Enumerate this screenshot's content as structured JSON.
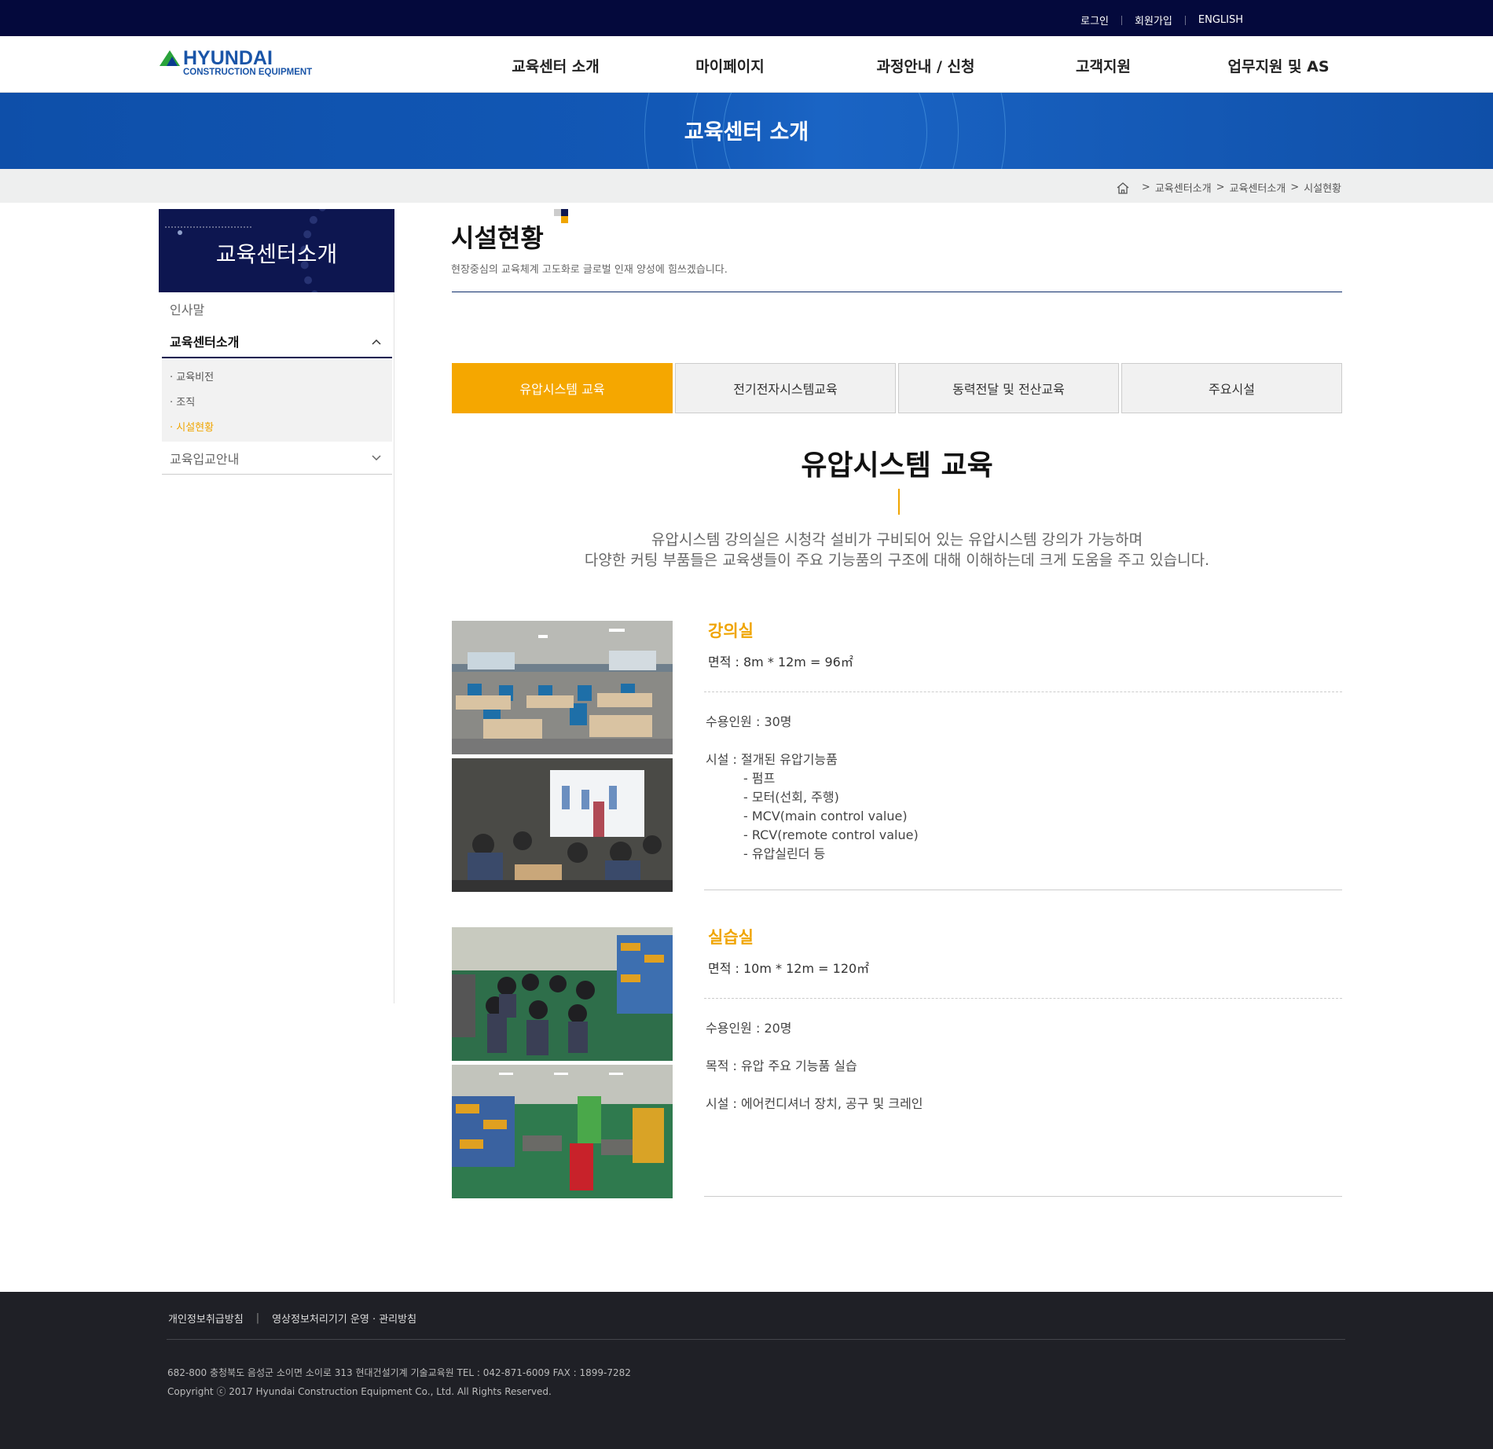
{
  "util": {
    "login": "로그인",
    "join": "회원가입",
    "english": "ENGLISH"
  },
  "logo": {
    "name": "HYUNDAI",
    "sub": "CONSTRUCTION EQUIPMENT"
  },
  "gnb": [
    "교육센터 소개",
    "마이페이지",
    "과정안내 / 신청",
    "고객지원",
    "업무지원 및 AS"
  ],
  "banner_title": "교육센터 소개",
  "breadcrumb": [
    "교육센터소개",
    "교육센터소개",
    "시설현황"
  ],
  "side": {
    "head": "교육센터소개",
    "items": [
      "인사말",
      "교육센터소개",
      "교육입교안내"
    ],
    "sub": [
      "· 교육비전",
      "· 조직",
      "· 시설현황"
    ]
  },
  "page": {
    "title": "시설현황",
    "subtitle": "현장중심의 교육체계 고도화로 글로벌 인재 양성에 힘쓰겠습니다."
  },
  "tabs": [
    "유압시스템 교육",
    "전기전자시스템교육",
    "동력전달 및 전산교육",
    "주요시설"
  ],
  "section": {
    "title": "유압시스템 교육",
    "desc1": "유압시스템 강의실은 시청각 설비가 구비되어 있는 유압시스템 강의가 가능하며",
    "desc2": "다양한 커팅 부품들은 교육생들이 주요 기능품의 구조에 대해 이해하는데 크게 도움을 주고 있습니다."
  },
  "rooms": [
    {
      "name": "강의실",
      "area": "면적 : 8m * 12m = 96㎡",
      "capacity": "수용인원 : 30명",
      "facility": "시설 : 절개된 유압기능품",
      "items": [
        "- 펌프",
        "- 모터(선회, 주행)",
        "- MCV(main control value)",
        "- RCV(remote control value)",
        "- 유압실린더 등"
      ]
    },
    {
      "name": "실습실",
      "area": "면적 : 10m * 12m = 120㎡",
      "capacity": "수용인원 : 20명",
      "purpose": "목적 : 유압 주요 기능품 실습",
      "facility": "시설 : 에어컨디셔너 장치, 공구 및 크레인"
    }
  ],
  "footer": {
    "link1": "개인정보취급방침",
    "link2": "영상정보처리기기 운영 · 관리방침",
    "address": "682-800  충청북도 음성군 소이면 소이로 313 현대건설기계 기술교육원 TEL : 042-871-6009 FAX : 1899-7282",
    "copyright": "Copyright ⓒ 2017 Hyundai Construction Equipment Co., Ltd. All Rights Reserved."
  },
  "colors": {
    "accent": "#f5a700",
    "navy": "#04093c",
    "banner": "#1258b6",
    "footer": "#1f2026"
  }
}
